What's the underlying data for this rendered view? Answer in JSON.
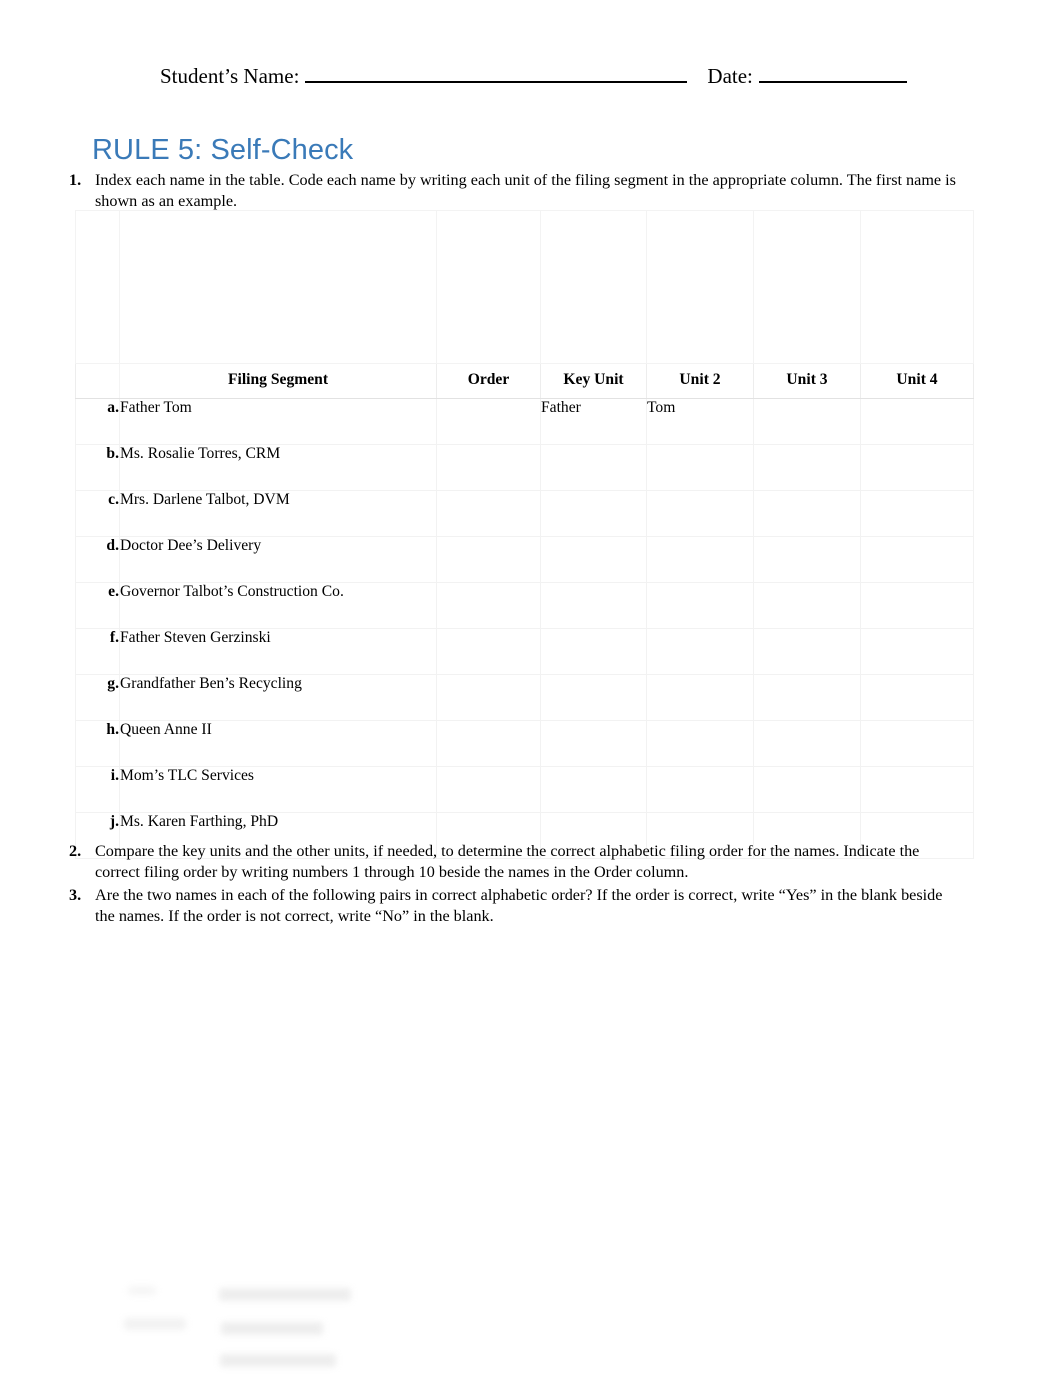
{
  "header": {
    "student_name_label": "Student’s Name:",
    "date_label": "Date:",
    "student_name_value": "",
    "date_value": ""
  },
  "title": "RULE 5: Self-Check",
  "instructions": [
    {
      "number": "1.",
      "text": "Index each name in the table. Code each name by writing each unit of the filing segment in the appropriate column. The first name is shown as an example."
    },
    {
      "number": "2.",
      "text": "Compare the key units and the other units, if needed, to determine the correct alphabetic filing order for the names. Indicate the correct filing order by writing numbers 1 through 10 beside the names in the Order column."
    },
    {
      "number": "3.",
      "text": "Are the two names in each of the following pairs in correct alphabetic order? If the order is correct, write “Yes” in the blank beside the names. If the order is not correct, write “No” in the blank."
    }
  ],
  "table": {
    "headers": {
      "letter": "",
      "filing_segment": "Filing Segment",
      "order": "Order",
      "key_unit": "Key Unit",
      "unit2": "Unit 2",
      "unit3": "Unit 3",
      "unit4": "Unit 4"
    },
    "rows": [
      {
        "letter": "a.",
        "filing_segment": "Father Tom",
        "order": "",
        "key_unit": "Father",
        "unit2": "Tom",
        "unit3": "",
        "unit4": ""
      },
      {
        "letter": "b.",
        "filing_segment": "Ms. Rosalie Torres, CRM",
        "order": "",
        "key_unit": "",
        "unit2": "",
        "unit3": "",
        "unit4": ""
      },
      {
        "letter": "c.",
        "filing_segment": "Mrs. Darlene Talbot, DVM",
        "order": "",
        "key_unit": "",
        "unit2": "",
        "unit3": "",
        "unit4": ""
      },
      {
        "letter": "d.",
        "filing_segment": "Doctor Dee’s Delivery",
        "order": "",
        "key_unit": "",
        "unit2": "",
        "unit3": "",
        "unit4": ""
      },
      {
        "letter": "e.",
        "filing_segment": "Governor Talbot’s Construction Co.",
        "order": "",
        "key_unit": "",
        "unit2": "",
        "unit3": "",
        "unit4": ""
      },
      {
        "letter": "f.",
        "filing_segment": "Father Steven Gerzinski",
        "order": "",
        "key_unit": "",
        "unit2": "",
        "unit3": "",
        "unit4": ""
      },
      {
        "letter": "g.",
        "filing_segment": "Grandfather Ben’s Recycling",
        "order": "",
        "key_unit": "",
        "unit2": "",
        "unit3": "",
        "unit4": ""
      },
      {
        "letter": "h.",
        "filing_segment": "Queen Anne II",
        "order": "",
        "key_unit": "",
        "unit2": "",
        "unit3": "",
        "unit4": ""
      },
      {
        "letter": "i.",
        "filing_segment": "Mom’s TLC Services",
        "order": "",
        "key_unit": "",
        "unit2": "",
        "unit3": "",
        "unit4": ""
      },
      {
        "letter": "j.",
        "filing_segment": "Ms. Karen Farthing, PhD",
        "order": "",
        "key_unit": "",
        "unit2": "",
        "unit3": "",
        "unit4": ""
      }
    ]
  },
  "colors": {
    "title_blue": "#3A7AB8",
    "text_black": "#000000",
    "table_border": "#f0f0f0"
  }
}
